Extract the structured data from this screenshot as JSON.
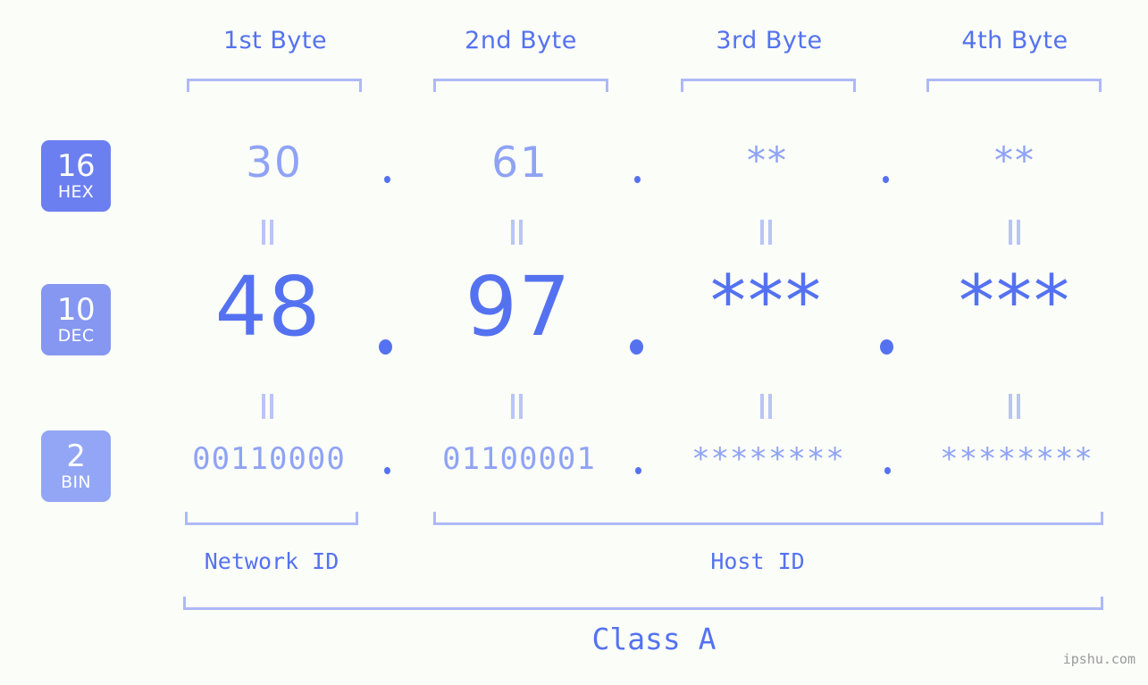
{
  "header": {
    "byte_labels": [
      "1st Byte",
      "2nd Byte",
      "3rd Byte",
      "4th Byte"
    ]
  },
  "bases": [
    {
      "num": "16",
      "name": "HEX",
      "color": "#6c7ff0"
    },
    {
      "num": "10",
      "name": "DEC",
      "color": "#8697f2"
    },
    {
      "num": "2",
      "name": "BIN",
      "color": "#93a6f5"
    }
  ],
  "rows": {
    "hex": {
      "values": [
        "30",
        "61",
        "**",
        "**"
      ],
      "separator": "."
    },
    "dec": {
      "values": [
        "48",
        "97",
        "***",
        "***"
      ],
      "separator": "."
    },
    "bin": {
      "values": [
        "00110000",
        "01100001",
        "********",
        "********"
      ],
      "separator": "."
    }
  },
  "equivalence_marker": "||",
  "sections": {
    "network_id": "Network ID",
    "host_id": "Host ID",
    "class": "Class A"
  },
  "watermark": "ipshu.com",
  "colors": {
    "background": "#fbfdf8",
    "primary_blue": "#5472f0",
    "light_blue": "#8fa3f5",
    "bracket_blue": "#adb9f7",
    "marker_blue": "#b9c4f8",
    "watermark_gray": "#9a9a9a"
  }
}
